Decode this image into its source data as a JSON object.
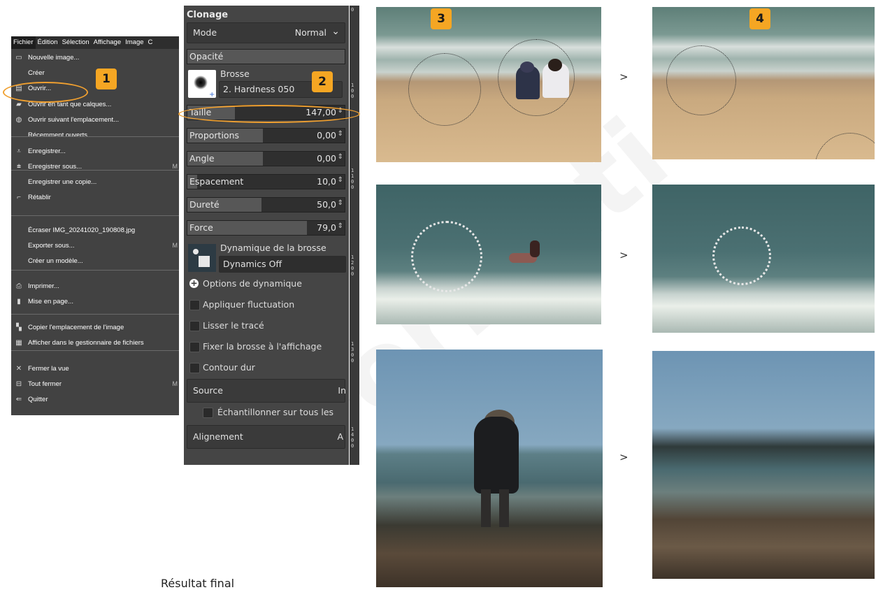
{
  "watermark": "Formation",
  "menu": {
    "bar": [
      "Fichier",
      "Édition",
      "Sélection",
      "Affichage",
      "Image",
      "C"
    ],
    "items": [
      {
        "label": "Nouvelle image...",
        "icon": "new-image-icon",
        "glyph": "▭"
      },
      {
        "label": "Créer",
        "icon": "",
        "glyph": ""
      },
      {
        "label": "Ouvrir...",
        "icon": "open-icon",
        "glyph": "▤"
      },
      {
        "label": "Ouvrir en tant que calques...",
        "icon": "open-layers-icon",
        "glyph": "▰"
      },
      {
        "label": "Ouvrir suivant l'emplacement...",
        "icon": "globe-icon",
        "glyph": "◍"
      },
      {
        "label": "Récemment ouverts",
        "icon": "",
        "glyph": ""
      },
      {
        "label": "Enregistrer...",
        "icon": "save-icon",
        "glyph": "⩡"
      },
      {
        "label": "Enregistrer sous...",
        "icon": "save-as-icon",
        "glyph": "⩧"
      },
      {
        "label": "Enregistrer une copie...",
        "icon": "",
        "glyph": ""
      },
      {
        "label": "Rétablir",
        "icon": "revert-icon",
        "glyph": "⌐"
      },
      {
        "label": "Écraser IMG_20241020_190808.jpg",
        "icon": "",
        "glyph": ""
      },
      {
        "label": "Exporter sous...",
        "icon": "",
        "glyph": ""
      },
      {
        "label": "Créer un modèle...",
        "icon": "",
        "glyph": ""
      },
      {
        "label": "Imprimer...",
        "icon": "print-icon",
        "glyph": "⎙"
      },
      {
        "label": "Mise en page...",
        "icon": "page-setup-icon",
        "glyph": "▮"
      },
      {
        "label": "Copier l'emplacement de l'image",
        "icon": "copy-location-icon",
        "glyph": "▚"
      },
      {
        "label": "Afficher dans le gestionnaire de fichiers",
        "icon": "file-manager-icon",
        "glyph": "▦"
      },
      {
        "label": "Fermer la vue",
        "icon": "close-icon",
        "glyph": "✕"
      },
      {
        "label": "Tout fermer",
        "icon": "close-all-icon",
        "glyph": "⊟"
      },
      {
        "label": "Quitter",
        "icon": "quit-icon",
        "glyph": "⇚"
      }
    ],
    "shortcut_marks": [
      "M",
      "M",
      "M"
    ]
  },
  "badges": [
    "1",
    "2",
    "3",
    "4"
  ],
  "tool": {
    "title": "Clonage",
    "mode_label": "Mode",
    "mode_value": "Normal",
    "opacity_label": "Opacité",
    "brush_label": "Brosse",
    "brush_value": "2. Hardness 050",
    "sliders": [
      {
        "label": "Taille",
        "value": "147,00",
        "fill": 0.3
      },
      {
        "label": "Proportions",
        "value": "0,00",
        "fill": 0.48
      },
      {
        "label": "Angle",
        "value": "0,00",
        "fill": 0.48
      },
      {
        "label": "Espacement",
        "value": "10,0",
        "fill": 0.06
      },
      {
        "label": "Dureté",
        "value": "50,0",
        "fill": 0.47
      },
      {
        "label": "Force",
        "value": "79,0",
        "fill": 0.76
      }
    ],
    "dynamics_label": "Dynamique de la brosse",
    "dynamics_value": "Dynamics Off",
    "dynamics_options": "Options de dynamique",
    "checks": [
      "Appliquer fluctuation",
      "Lisser le tracé",
      "Fixer la brosse à l'affichage",
      "Contour dur"
    ],
    "source_label": "Source",
    "source_value": "In",
    "sample_label": "Échantillonner sur tous les",
    "align_label": "Alignement",
    "align_value": "A"
  },
  "ruler": [
    "0",
    "1 0 0",
    "1 1 0 0",
    "1 2 0 0",
    "1 3 0 0",
    "1 4 0 0"
  ],
  "arrows": [
    ">",
    ">",
    ">"
  ],
  "final_label": "Résultat final"
}
